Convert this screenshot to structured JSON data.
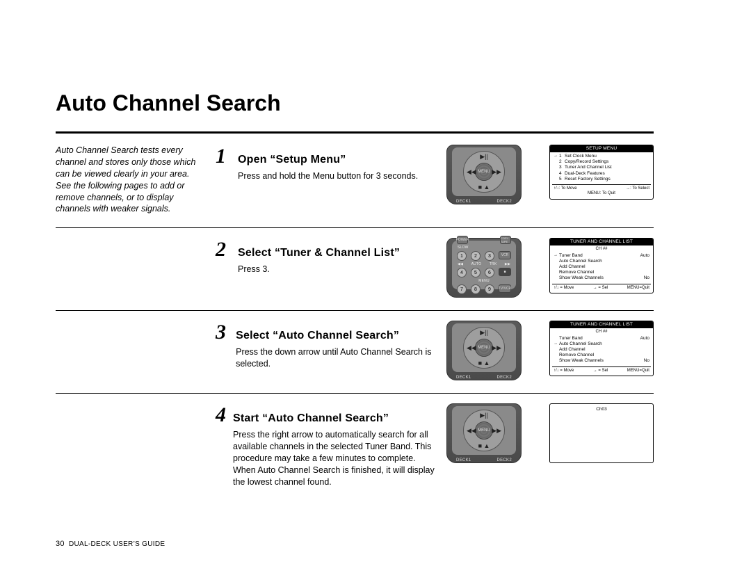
{
  "title": "Auto Channel Search",
  "intro": "Auto Channel Search tests every channel and stores only those which can be viewed clearly in your area. See the following pages to add or remove channels, or to display channels with weaker signals.",
  "steps": [
    {
      "num": "1",
      "title": "Open “Setup Menu”",
      "desc": "Press and hold the Menu button for 3 seconds.",
      "remote_type": "dpad",
      "osd": {
        "title": "SETUP MENU",
        "items": [
          {
            "ptr": "→",
            "num": "1",
            "label": "Set Clock Menu"
          },
          {
            "ptr": "",
            "num": "2",
            "label": "Copy/Record Settings"
          },
          {
            "ptr": "",
            "num": "3",
            "label": "Tuner And Channel List"
          },
          {
            "ptr": "",
            "num": "4",
            "label": "Dual-Deck Features"
          },
          {
            "ptr": "",
            "num": "5",
            "label": "Reset Factory Settings"
          }
        ],
        "foot_left": "↑/↓: To Move",
        "foot_right": "→: To Select",
        "foot_mid": "MENU: To Quit"
      }
    },
    {
      "num": "2",
      "title": "Select “Tuner & Channel List”",
      "desc": "Press 3.",
      "remote_type": "numpad",
      "osd": {
        "title": "TUNER AND CHANNEL LIST",
        "sub": "CH ##",
        "items": [
          {
            "ptr": "→",
            "label": "Tuner Band",
            "val": "Auto"
          },
          {
            "ptr": "",
            "label": "Auto Channel Search"
          },
          {
            "ptr": "",
            "label": "Add Channel"
          },
          {
            "ptr": "",
            "label": "Remove Channel"
          },
          {
            "ptr": "",
            "label": "Show Weak Channels",
            "val": "No"
          }
        ],
        "foot_left": "↑/↓ = Move",
        "foot_mid": "→ = Sel",
        "foot_right": "MENU=Quit"
      }
    },
    {
      "num": "3",
      "title": "Select “Auto Channel Search”",
      "desc": "Press the down arrow until Auto Channel Search is selected.",
      "remote_type": "dpad",
      "osd": {
        "title": "TUNER AND CHANNEL LIST",
        "sub": "CH ##",
        "items": [
          {
            "ptr": "",
            "label": "Tuner Band",
            "val": "Auto"
          },
          {
            "ptr": "→",
            "label": "Auto Channel Search"
          },
          {
            "ptr": "",
            "label": "Add Channel"
          },
          {
            "ptr": "",
            "label": "Remove Channel"
          },
          {
            "ptr": "",
            "label": "Show Weak Channels",
            "val": "No"
          }
        ],
        "foot_left": "↑/↓ = Move",
        "foot_mid": "→ = Sel",
        "foot_right": "MENU=Quit"
      }
    },
    {
      "num": "4",
      "title": "Start “Auto Channel Search”",
      "desc": "Press the right arrow to automatically search for all available channels in the selected Tuner Band. This procedure may take a few minutes to complete. When Auto Channel Search is finished, it will display the lowest channel found.",
      "remote_type": "dpad",
      "osd_blank": {
        "ch": "Ch03"
      }
    }
  ],
  "remote": {
    "deck1": "DECK1",
    "deck2": "DECK2",
    "menu": "MENU",
    "power": "POWER",
    "copytape": "COPY TAPE",
    "vcr": "VCR",
    "tvvcr": "TV/VCR",
    "auto": "AUTO",
    "slow": "SLOW",
    "trk": "TRK"
  },
  "footer": {
    "page": "30",
    "guide": "DUAL-DECK USER’S GUIDE"
  }
}
